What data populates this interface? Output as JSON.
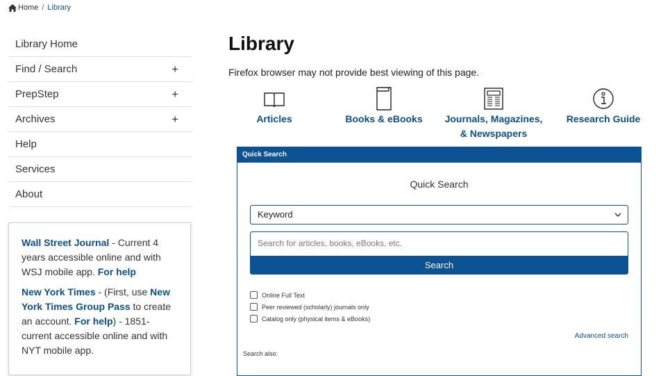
{
  "breadcrumb": {
    "home": "Home",
    "separator": "/",
    "current": "Library"
  },
  "sidebar": {
    "items": [
      {
        "label": "Library Home",
        "expand": ""
      },
      {
        "label": "Find / Search",
        "expand": "+"
      },
      {
        "label": "PrepStep",
        "expand": "+"
      },
      {
        "label": "Archives",
        "expand": "+"
      },
      {
        "label": "Help",
        "expand": ""
      },
      {
        "label": "Services",
        "expand": ""
      },
      {
        "label": "About",
        "expand": ""
      }
    ]
  },
  "infobox": {
    "wsj_link": "Wall Street Journal",
    "wsj_text": " - Current 4 years accessible online and with WSJ mobile app. ",
    "wsj_help": "For help",
    "nyt_link": "New York Times",
    "nyt_text1": " - (First, use ",
    "nyt_pass": "New York Times Group Pass",
    "nyt_text2": " to create an account. ",
    "nyt_help": "For help",
    "nyt_text3": ") - 1851-current accessible online and with NYT mobile app."
  },
  "main": {
    "title": "Library",
    "note": "Firefox browser may not provide best viewing of this page.",
    "categories": [
      {
        "label": "Articles",
        "icon": "open-book-icon"
      },
      {
        "label": "Books & eBooks",
        "icon": "book-icon"
      },
      {
        "label": "Journals, Magazines,",
        "label2": "& Newspapers",
        "icon": "newspaper-icon"
      },
      {
        "label": "Research Guide",
        "icon": "info-icon"
      }
    ]
  },
  "quick_search": {
    "header": "Quick Search",
    "title": "Quick Search",
    "select_value": "Keyword",
    "placeholder": "Search for articles, books, eBooks, etc.",
    "button": "Search",
    "options": [
      "Online Full Text",
      "Peer reviewed (scholarly) journals only",
      "Catalog only (physical items & eBooks)"
    ],
    "advanced": "Advanced search",
    "search_also": "Search also:"
  },
  "colors": {
    "brand": "#0b5394",
    "link": "#0b4f8a"
  }
}
